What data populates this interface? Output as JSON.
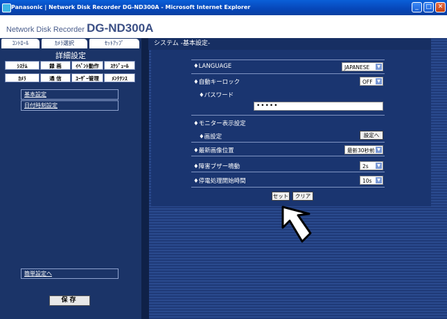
{
  "window": {
    "title": "Panasonic | Network Disk Recorder DG-ND300A - Microsoft Internet Explorer",
    "min": "_",
    "max": "□",
    "close": "✕"
  },
  "brand": {
    "prefix": "Network Disk Recorder",
    "model": "DG-ND300A"
  },
  "tabs": {
    "control": "ｺﾝﾄﾛｰﾙ",
    "camera_select": "ｶﾒﾗ選択",
    "setup": "ｾｯﾄｱｯﾌﾟ"
  },
  "left": {
    "title": "詳細設定",
    "categories": [
      "ｼｽﾃﾑ",
      "録 画",
      "ｲﾍﾞﾝﾄ動作",
      "ｽｹｼﾞｭｰﾙ",
      "ｶﾒﾗ",
      "通 信",
      "ﾕｰｻﾞｰ管理",
      "ﾒﾝﾃﾅﾝｽ"
    ],
    "submenu": [
      "基本設定",
      "日付時刻設定"
    ],
    "easy_setup": "簡単設定へ",
    "save": "保存"
  },
  "main": {
    "title": "システム -基本設定-",
    "language": {
      "label": "♦LANGUAGE",
      "value": "JAPANESE"
    },
    "autokeylock": {
      "label": "♦自動キーロック",
      "value": "OFF"
    },
    "password": {
      "label": "♦パスワード",
      "value": "•••••"
    },
    "monitor": {
      "label": "♦モニター表示設定"
    },
    "screen": {
      "label": "♦画設定",
      "button": "設定へ"
    },
    "latest_image": {
      "label": "♦最新画像位置",
      "value": "最新30秒前"
    },
    "buzzer": {
      "label": "♦障害ブザー鳴動",
      "value": "2s"
    },
    "power_fail": {
      "label": "♦停電処理開始時間",
      "value": "10s"
    },
    "set": "セット",
    "clear": "クリア"
  }
}
